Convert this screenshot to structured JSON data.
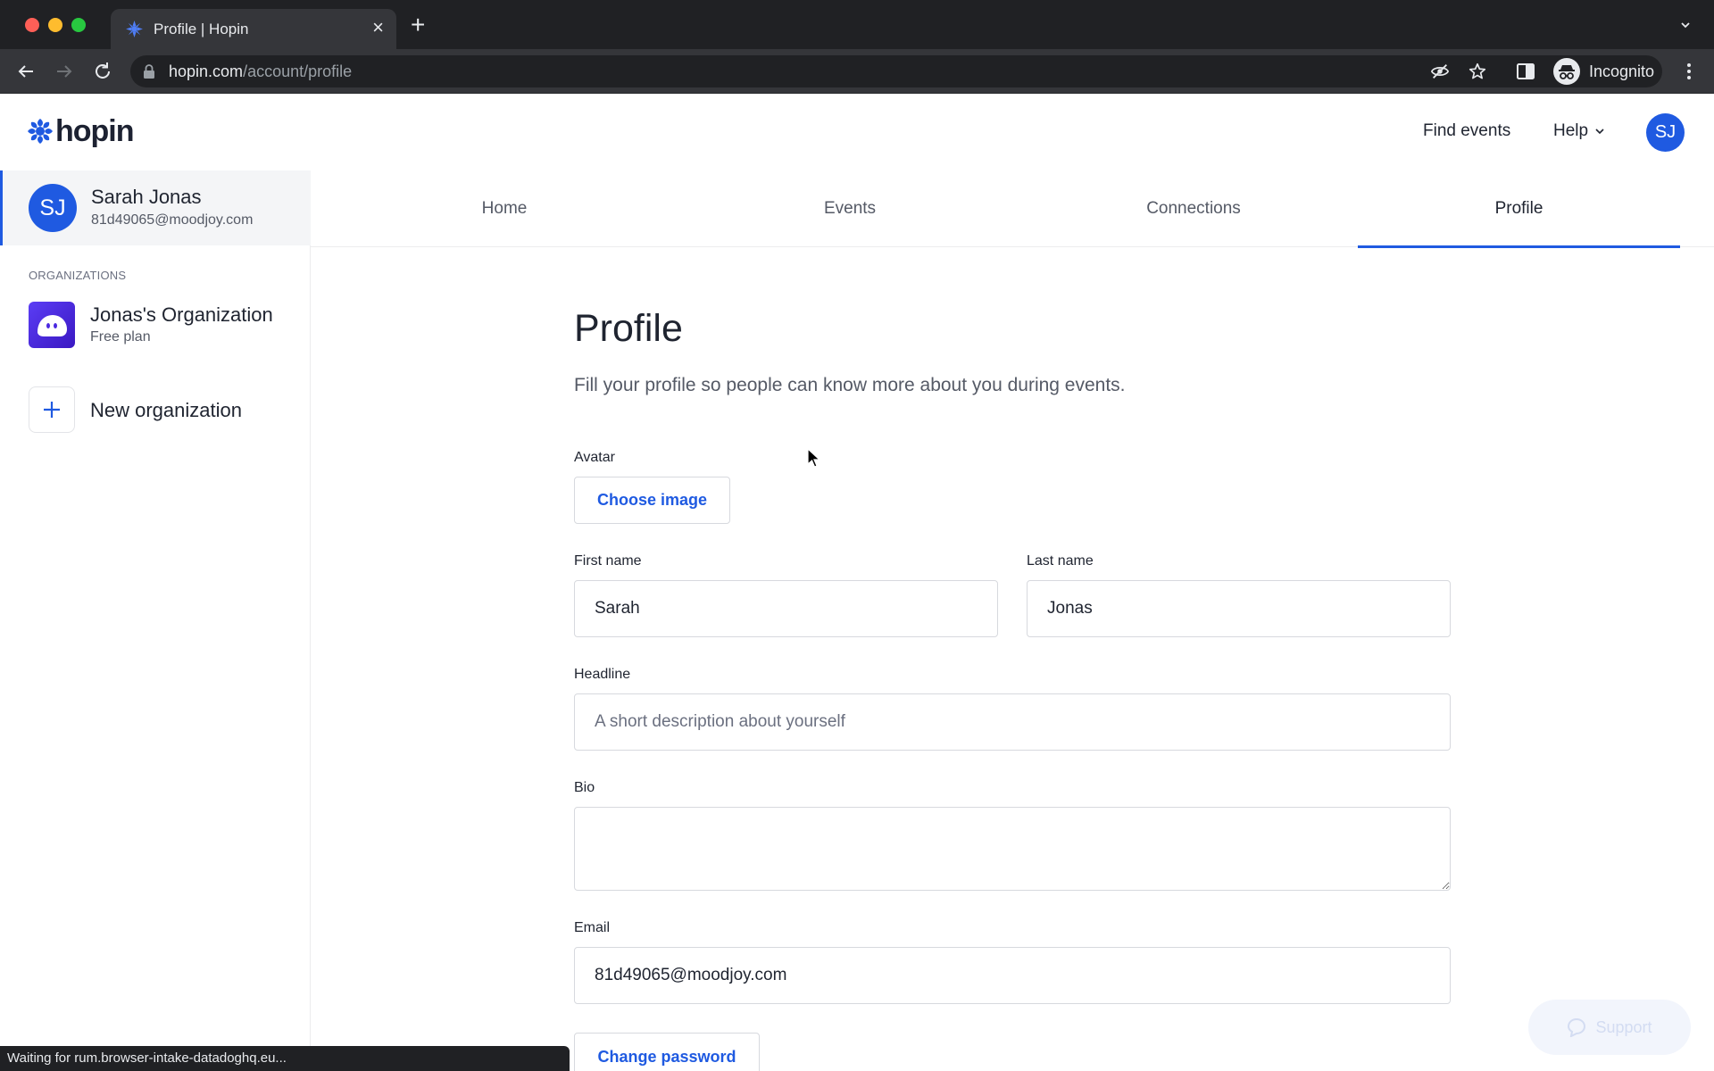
{
  "browser": {
    "tab_title": "Profile | Hopin",
    "url_host": "hopin.com",
    "url_path": "/account/profile",
    "profile_label": "Incognito",
    "status_text": "Waiting for rum.browser-intake-datadoghq.eu..."
  },
  "header": {
    "logo_text": "hopin",
    "find_events": "Find events",
    "help": "Help",
    "avatar_initials": "SJ"
  },
  "sidebar": {
    "user": {
      "initials": "SJ",
      "name": "Sarah Jonas",
      "email": "81d49065@moodjoy.com"
    },
    "section_label": "ORGANIZATIONS",
    "org": {
      "name": "Jonas's Organization",
      "plan": "Free plan"
    },
    "new_org_label": "New organization"
  },
  "tabs": [
    {
      "label": "Home"
    },
    {
      "label": "Events"
    },
    {
      "label": "Connections"
    },
    {
      "label": "Profile",
      "active": true
    }
  ],
  "form": {
    "title": "Profile",
    "subtitle": "Fill your profile so people can know more about you during events.",
    "avatar_label": "Avatar",
    "choose_image": "Choose image",
    "first_name_label": "First name",
    "first_name_value": "Sarah",
    "last_name_label": "Last name",
    "last_name_value": "Jonas",
    "headline_label": "Headline",
    "headline_placeholder": "A short description about yourself",
    "bio_label": "Bio",
    "email_label": "Email",
    "email_value": "81d49065@moodjoy.com",
    "change_password": "Change password"
  },
  "support_label": "Support",
  "colors": {
    "brand_blue": "#1f5ae1",
    "org_purple": "#4a28e0"
  }
}
